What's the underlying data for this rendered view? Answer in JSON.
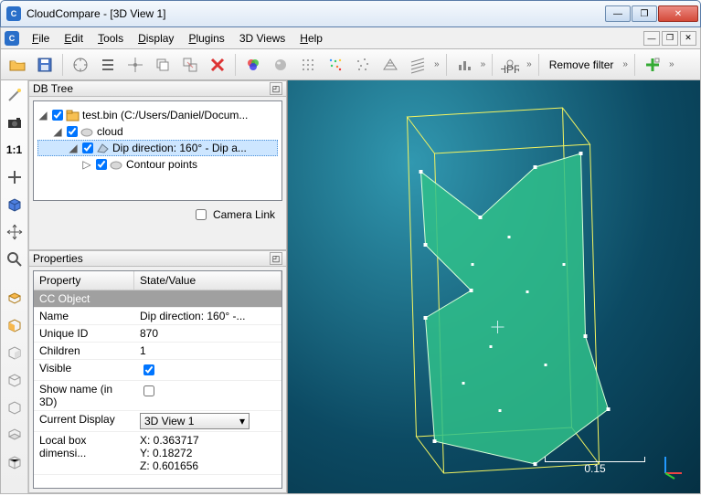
{
  "window": {
    "title": "CloudCompare - [3D View 1]"
  },
  "menu": {
    "file": "File",
    "edit": "Edit",
    "tools": "Tools",
    "display": "Display",
    "plugins": "Plugins",
    "views3d": "3D Views",
    "help": "Help"
  },
  "toolbar": {
    "remove_filter": "Remove filter",
    "hpr": "HPR"
  },
  "lefttools": {
    "scale_label": "1:1"
  },
  "panels": {
    "dbtree": {
      "title": "DB Tree",
      "camera_link": "Camera Link",
      "items": [
        {
          "label": "test.bin (C:/Users/Daniel/Docum...",
          "depth": 0,
          "expanded": true,
          "checked": true,
          "icon": "folder"
        },
        {
          "label": "cloud",
          "depth": 1,
          "expanded": true,
          "checked": true,
          "icon": "cloud"
        },
        {
          "label": "Dip direction: 160° - Dip a...",
          "depth": 2,
          "expanded": true,
          "checked": true,
          "icon": "facet",
          "selected": true
        },
        {
          "label": "Contour points",
          "depth": 3,
          "expanded": false,
          "checked": true,
          "icon": "cloud"
        }
      ]
    },
    "properties": {
      "title": "Properties",
      "columns": {
        "c1": "Property",
        "c2": "State/Value"
      },
      "section": "CC Object",
      "rows": [
        {
          "k": "Name",
          "v": "Dip direction: 160° -..."
        },
        {
          "k": "Unique ID",
          "v": "870"
        },
        {
          "k": "Children",
          "v": "1"
        },
        {
          "k": "Visible",
          "v": "",
          "type": "check",
          "checked": true
        },
        {
          "k": "Show name (in 3D)",
          "v": "",
          "type": "check",
          "checked": false
        },
        {
          "k": "Current Display",
          "v": "3D View 1",
          "type": "select"
        },
        {
          "k": "Local box dimensi...",
          "v": "X: 0.363717\nY: 0.18272\nZ: 0.601656",
          "type": "multi"
        }
      ]
    }
  },
  "viewport": {
    "scale_value": "0.15"
  }
}
